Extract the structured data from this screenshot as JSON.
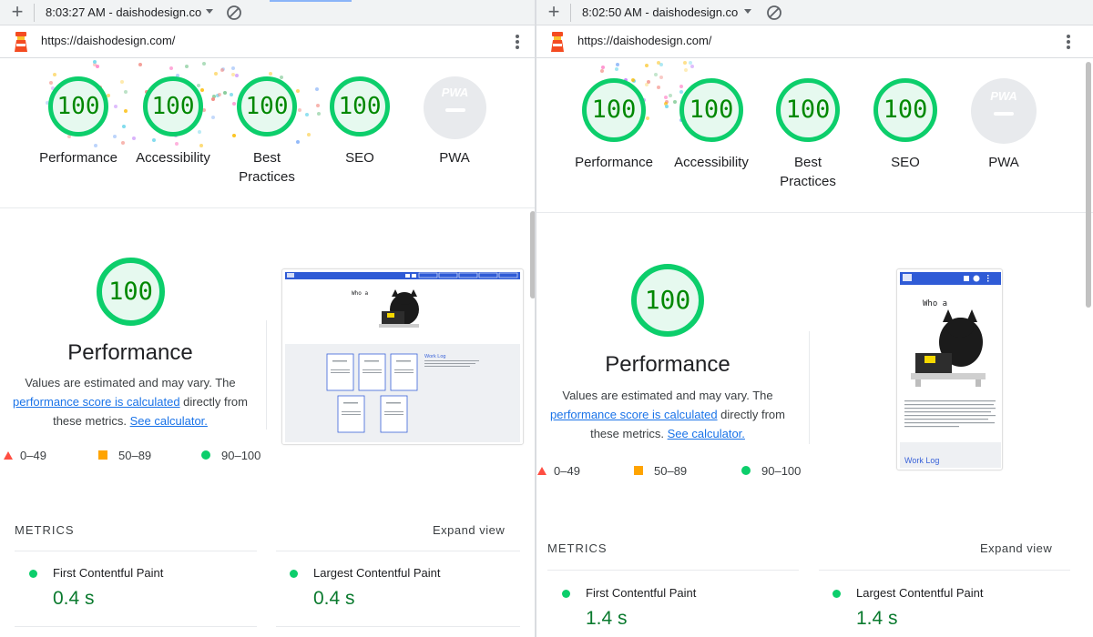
{
  "left": {
    "tab_title": "8:03:27 AM - daishodesign.co",
    "url": "https://daishodesign.com/",
    "scores": [
      {
        "label": "Performance",
        "value": "100"
      },
      {
        "label": "Accessibility",
        "value": "100"
      },
      {
        "label": "Best Practices",
        "value": "100"
      },
      {
        "label": "SEO",
        "value": "100"
      },
      {
        "label": "PWA",
        "value": ""
      }
    ],
    "pwa_badge": "PWA",
    "perf": {
      "score": "100",
      "title": "Performance",
      "desc_1": "Values are estimated and may vary. The",
      "desc_link": "performance score is calculated",
      "desc_2": " directly from",
      "desc_3": "these metrics. ",
      "desc_link2": "See calculator."
    },
    "legend": {
      "red": "0–49",
      "orange": "50–89",
      "green": "90–100"
    },
    "metrics_heading": "METRICS",
    "expand": "Expand view",
    "metrics": [
      {
        "name": "First Contentful Paint",
        "value": "0.4 s"
      },
      {
        "name": "Largest Contentful Paint",
        "value": "0.4 s"
      }
    ]
  },
  "right": {
    "tab_title": "8:02:50 AM - daishodesign.co",
    "url": "https://daishodesign.com/",
    "scores": [
      {
        "label": "Performance",
        "value": "100"
      },
      {
        "label": "Accessibility",
        "value": "100"
      },
      {
        "label": "Best Practices",
        "value": "100"
      },
      {
        "label": "SEO",
        "value": "100"
      },
      {
        "label": "PWA",
        "value": ""
      }
    ],
    "pwa_badge": "PWA",
    "perf": {
      "score": "100",
      "title": "Performance",
      "desc_1": "Values are estimated and may vary. The",
      "desc_link": "performance score is calculated",
      "desc_2": " directly from",
      "desc_3": "these metrics. ",
      "desc_link2": "See calculator."
    },
    "legend": {
      "red": "0–49",
      "orange": "50–89",
      "green": "90–100"
    },
    "metrics_heading": "METRICS",
    "expand": "Expand view",
    "metrics": [
      {
        "name": "First Contentful Paint",
        "value": "1.4 s"
      },
      {
        "name": "Largest Contentful Paint",
        "value": "1.4 s"
      }
    ]
  },
  "thumbnail": {
    "hero_text": "Who a",
    "link_text": "Work Log"
  },
  "colors": {
    "pass": "#0cce6b",
    "pass_text": "#008800",
    "average": "#ffa400",
    "fail": "#ff4e42",
    "link": "#1a73e8"
  }
}
